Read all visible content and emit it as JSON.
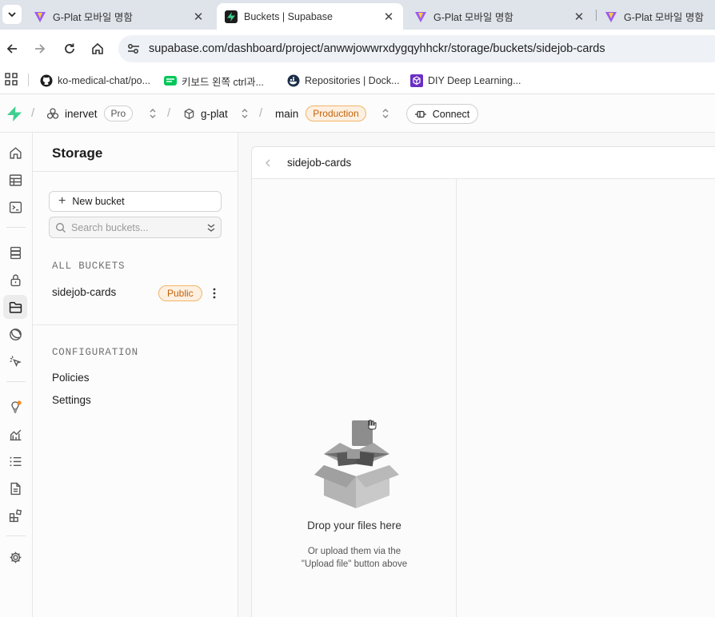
{
  "browser": {
    "tabs": [
      {
        "title": "G-Plat 모바일 명함",
        "active": false
      },
      {
        "title": "Buckets | Supabase",
        "active": true
      },
      {
        "title": "G-Plat 모바일 명함",
        "active": false
      },
      {
        "title": "G-Plat 모바일 명함",
        "active": false
      }
    ],
    "close_glyph": "✕",
    "url": "supabase.com/dashboard/project/anwwjowwrxdygqyhhckr/storage/buckets/sidejob-cards",
    "bookmarks": [
      {
        "label": "ko-medical-chat/po...",
        "icon": "github-icon"
      },
      {
        "label": "키보드 왼쪽 ctrl과...",
        "icon": "blog-icon"
      },
      {
        "label": "Repositories | Dock...",
        "icon": "docker-icon"
      },
      {
        "label": "DIY Deep Learning...",
        "icon": "cube-icon"
      }
    ]
  },
  "topnav": {
    "org": "inervet",
    "org_plan": "Pro",
    "project": "g-plat",
    "branch": "main",
    "branch_env": "Production",
    "connect_label": "Connect",
    "separator": "/"
  },
  "sidebar": {
    "title": "Storage",
    "new_bucket_label": "New bucket",
    "new_bucket_plus": "+",
    "search_placeholder": "Search buckets...",
    "all_buckets_label": "ALL BUCKETS",
    "buckets": [
      {
        "name": "sidejob-cards",
        "badge": "Public"
      }
    ],
    "configuration_label": "CONFIGURATION",
    "config_items": [
      "Policies",
      "Settings"
    ]
  },
  "main": {
    "bucket_title": "sidejob-cards",
    "drop_title": "Drop your files here",
    "drop_sub_line1": "Or upload them via the",
    "drop_sub_line2": "\"Upload file\" button above"
  },
  "colors": {
    "brand": "#3ecf8e",
    "badge_orange_bg": "#fdf0e0",
    "badge_orange_text": "#c2620c",
    "notification_dot": "#f08a24"
  }
}
